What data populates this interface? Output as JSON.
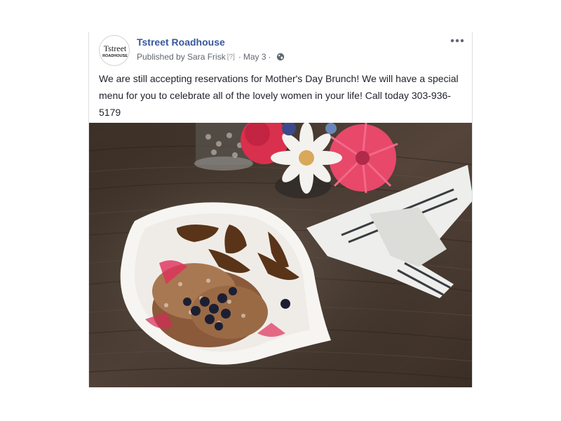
{
  "post": {
    "page_name": "Tstreet Roadhouse",
    "avatar_logo": {
      "line1": "Tstreet",
      "line2": "ROADHOUSE"
    },
    "published_by": "Published by Sara Frisk",
    "help_marker": "[?]",
    "separator": "·",
    "date": "May 3",
    "audience_icon": "globe-icon",
    "menu_icon": "more-options-icon",
    "text": "We are still accepting reservations for Mother's Day Brunch! We will have a special menu for you to celebrate all of the lovely women in your life! Call today 303-936-5179",
    "photo_subject": "french-toast-plate-with-blueberries-and-flowers"
  },
  "colors": {
    "page_name": "#385898",
    "meta_text": "#616770",
    "body_text": "#1d2129",
    "table_wood": "#4a3a2c",
    "flower_pink": "#e8486a"
  }
}
